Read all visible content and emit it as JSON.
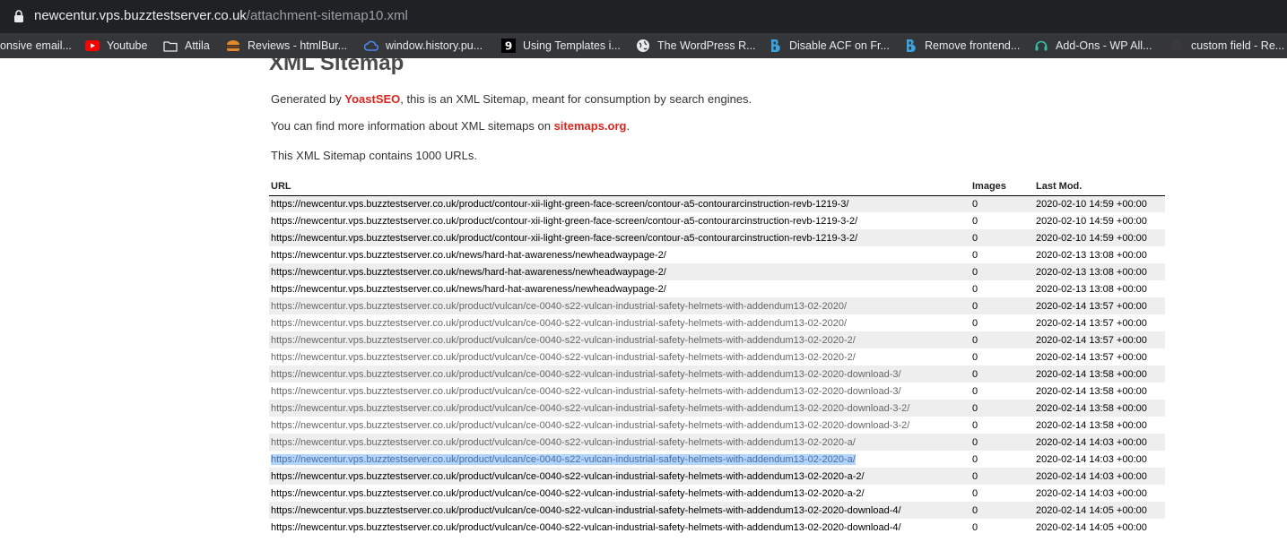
{
  "browser": {
    "url_host": "newcentur.vps.buzztestserver.co.uk",
    "url_path": "/attachment-sitemap10.xml",
    "bookmarks": [
      {
        "label": "onsive email...",
        "icon": "none"
      },
      {
        "label": "Youtube",
        "icon": "youtube-icon"
      },
      {
        "label": "Attila",
        "icon": "folder-icon"
      },
      {
        "label": "Reviews - htmlBur...",
        "icon": "burger-icon"
      },
      {
        "label": "window.history.pu...",
        "icon": "cloud-icon"
      },
      {
        "label": "Using Templates i...",
        "icon": "nine-icon"
      },
      {
        "label": "The WordPress R...",
        "icon": "globe-icon"
      },
      {
        "label": "Disable ACF on Fr...",
        "icon": "b-icon"
      },
      {
        "label": "Remove frontend...",
        "icon": "b-icon"
      },
      {
        "label": "Add-Ons - WP All...",
        "icon": "headset-icon"
      },
      {
        "label": "custom field - Re...",
        "icon": "none"
      }
    ]
  },
  "page": {
    "title": "XML Sitemap",
    "intro1_pre": "Generated by ",
    "intro1_link": "YoastSEO",
    "intro1_post": ", this is an XML Sitemap, meant for consumption by search engines.",
    "intro2_pre": "You can find more information about XML sitemaps on ",
    "intro2_link": "sitemaps.org",
    "intro2_post": ".",
    "intro3": "This XML Sitemap contains 1000 URLs."
  },
  "table": {
    "headers": {
      "url": "URL",
      "images": "Images",
      "lastmod": "Last Mod."
    },
    "rows": [
      {
        "url": "https://newcentur.vps.buzztestserver.co.uk/product/contour-xii-light-green-face-screen/contour-a5-contourarcinstruction-revb-1219-3/",
        "images": "0",
        "lastmod": "2020-02-10 14:59 +00:00"
      },
      {
        "url": "https://newcentur.vps.buzztestserver.co.uk/product/contour-xii-light-green-face-screen/contour-a5-contourarcinstruction-revb-1219-3-2/",
        "images": "0",
        "lastmod": "2020-02-10 14:59 +00:00"
      },
      {
        "url": "https://newcentur.vps.buzztestserver.co.uk/product/contour-xii-light-green-face-screen/contour-a5-contourarcinstruction-revb-1219-3-2/",
        "images": "0",
        "lastmod": "2020-02-10 14:59 +00:00"
      },
      {
        "url": "https://newcentur.vps.buzztestserver.co.uk/news/hard-hat-awareness/newheadwaypage-2/",
        "images": "0",
        "lastmod": "2020-02-13 13:08 +00:00"
      },
      {
        "url": "https://newcentur.vps.buzztestserver.co.uk/news/hard-hat-awareness/newheadwaypage-2/",
        "images": "0",
        "lastmod": "2020-02-13 13:08 +00:00"
      },
      {
        "url": "https://newcentur.vps.buzztestserver.co.uk/news/hard-hat-awareness/newheadwaypage-2/",
        "images": "0",
        "lastmod": "2020-02-13 13:08 +00:00"
      },
      {
        "url": "https://newcentur.vps.buzztestserver.co.uk/product/vulcan/ce-0040-s22-vulcan-industrial-safety-helmets-with-addendum13-02-2020/",
        "images": "0",
        "lastmod": "2020-02-14 13:57 +00:00"
      },
      {
        "url": "https://newcentur.vps.buzztestserver.co.uk/product/vulcan/ce-0040-s22-vulcan-industrial-safety-helmets-with-addendum13-02-2020/",
        "images": "0",
        "lastmod": "2020-02-14 13:57 +00:00"
      },
      {
        "url": "https://newcentur.vps.buzztestserver.co.uk/product/vulcan/ce-0040-s22-vulcan-industrial-safety-helmets-with-addendum13-02-2020-2/",
        "images": "0",
        "lastmod": "2020-02-14 13:57 +00:00"
      },
      {
        "url": "https://newcentur.vps.buzztestserver.co.uk/product/vulcan/ce-0040-s22-vulcan-industrial-safety-helmets-with-addendum13-02-2020-2/",
        "images": "0",
        "lastmod": "2020-02-14 13:57 +00:00"
      },
      {
        "url": "https://newcentur.vps.buzztestserver.co.uk/product/vulcan/ce-0040-s22-vulcan-industrial-safety-helmets-with-addendum13-02-2020-download-3/",
        "images": "0",
        "lastmod": "2020-02-14 13:58 +00:00"
      },
      {
        "url": "https://newcentur.vps.buzztestserver.co.uk/product/vulcan/ce-0040-s22-vulcan-industrial-safety-helmets-with-addendum13-02-2020-download-3/",
        "images": "0",
        "lastmod": "2020-02-14 13:58 +00:00"
      },
      {
        "url": "https://newcentur.vps.buzztestserver.co.uk/product/vulcan/ce-0040-s22-vulcan-industrial-safety-helmets-with-addendum13-02-2020-download-3-2/",
        "images": "0",
        "lastmod": "2020-02-14 13:58 +00:00"
      },
      {
        "url": "https://newcentur.vps.buzztestserver.co.uk/product/vulcan/ce-0040-s22-vulcan-industrial-safety-helmets-with-addendum13-02-2020-download-3-2/",
        "images": "0",
        "lastmod": "2020-02-14 13:58 +00:00"
      },
      {
        "url": "https://newcentur.vps.buzztestserver.co.uk/product/vulcan/ce-0040-s22-vulcan-industrial-safety-helmets-with-addendum13-02-2020-a/",
        "images": "0",
        "lastmod": "2020-02-14 14:03 +00:00"
      },
      {
        "url": "https://newcentur.vps.buzztestserver.co.uk/product/vulcan/ce-0040-s22-vulcan-industrial-safety-helmets-with-addendum13-02-2020-a/",
        "images": "0",
        "lastmod": "2020-02-14 14:03 +00:00"
      },
      {
        "url": "https://newcentur.vps.buzztestserver.co.uk/product/vulcan/ce-0040-s22-vulcan-industrial-safety-helmets-with-addendum13-02-2020-a-2/",
        "images": "0",
        "lastmod": "2020-02-14 14:03 +00:00"
      },
      {
        "url": "https://newcentur.vps.buzztestserver.co.uk/product/vulcan/ce-0040-s22-vulcan-industrial-safety-helmets-with-addendum13-02-2020-a-2/",
        "images": "0",
        "lastmod": "2020-02-14 14:03 +00:00"
      },
      {
        "url": "https://newcentur.vps.buzztestserver.co.uk/product/vulcan/ce-0040-s22-vulcan-industrial-safety-helmets-with-addendum13-02-2020-download-4/",
        "images": "0",
        "lastmod": "2020-02-14 14:05 +00:00"
      },
      {
        "url": "https://newcentur.vps.buzztestserver.co.uk/product/vulcan/ce-0040-s22-vulcan-industrial-safety-helmets-with-addendum13-02-2020-download-4/",
        "images": "0",
        "lastmod": "2020-02-14 14:05 +00:00"
      }
    ]
  }
}
